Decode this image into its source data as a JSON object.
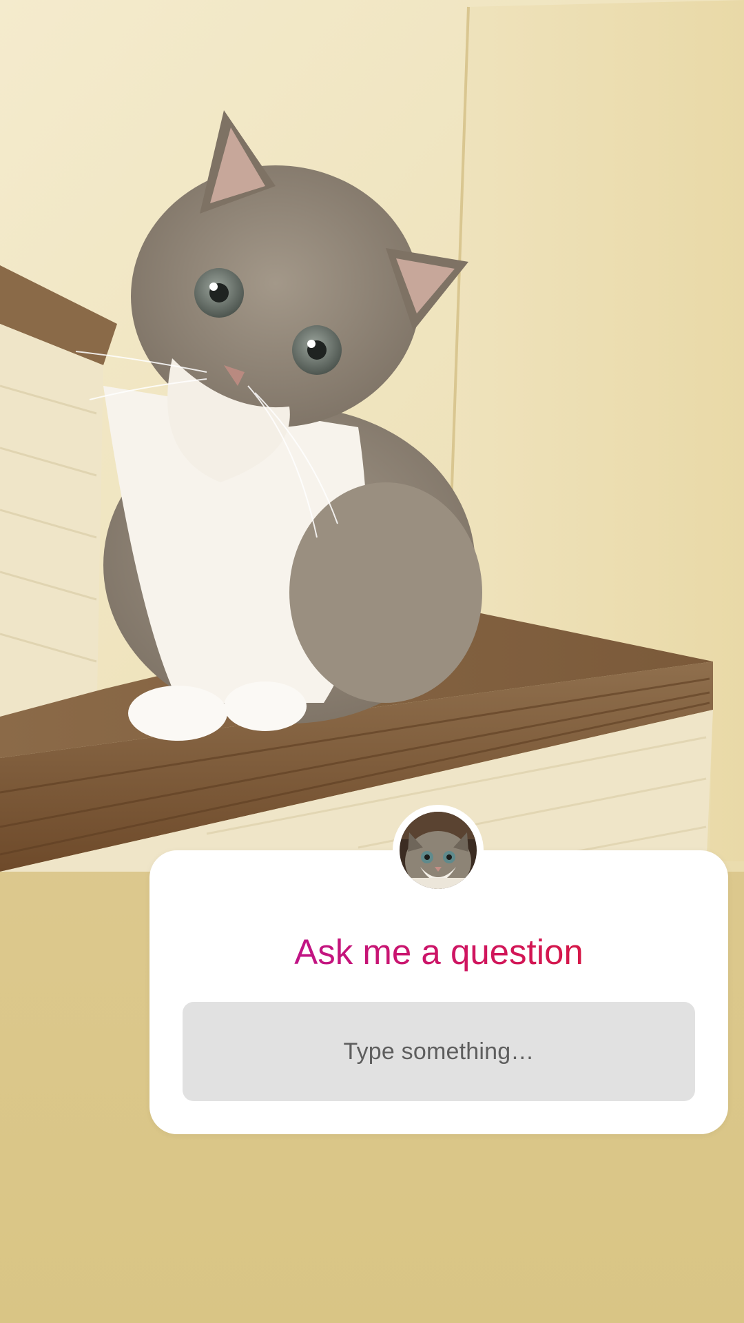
{
  "story": {
    "background_photo": "cat-on-stairs-photo"
  },
  "question_sticker": {
    "avatar_icon": "cat-avatar",
    "title": "Ask me a question",
    "title_gradient": [
      "#b414a6",
      "#dd1b2a"
    ],
    "answer_placeholder": "Type something…"
  },
  "colors": {
    "background_top": "#e6d6a3",
    "background_bottom": "#d9c585",
    "field_background": "#e1e1e1",
    "placeholder_text": "#5e5e5e"
  }
}
